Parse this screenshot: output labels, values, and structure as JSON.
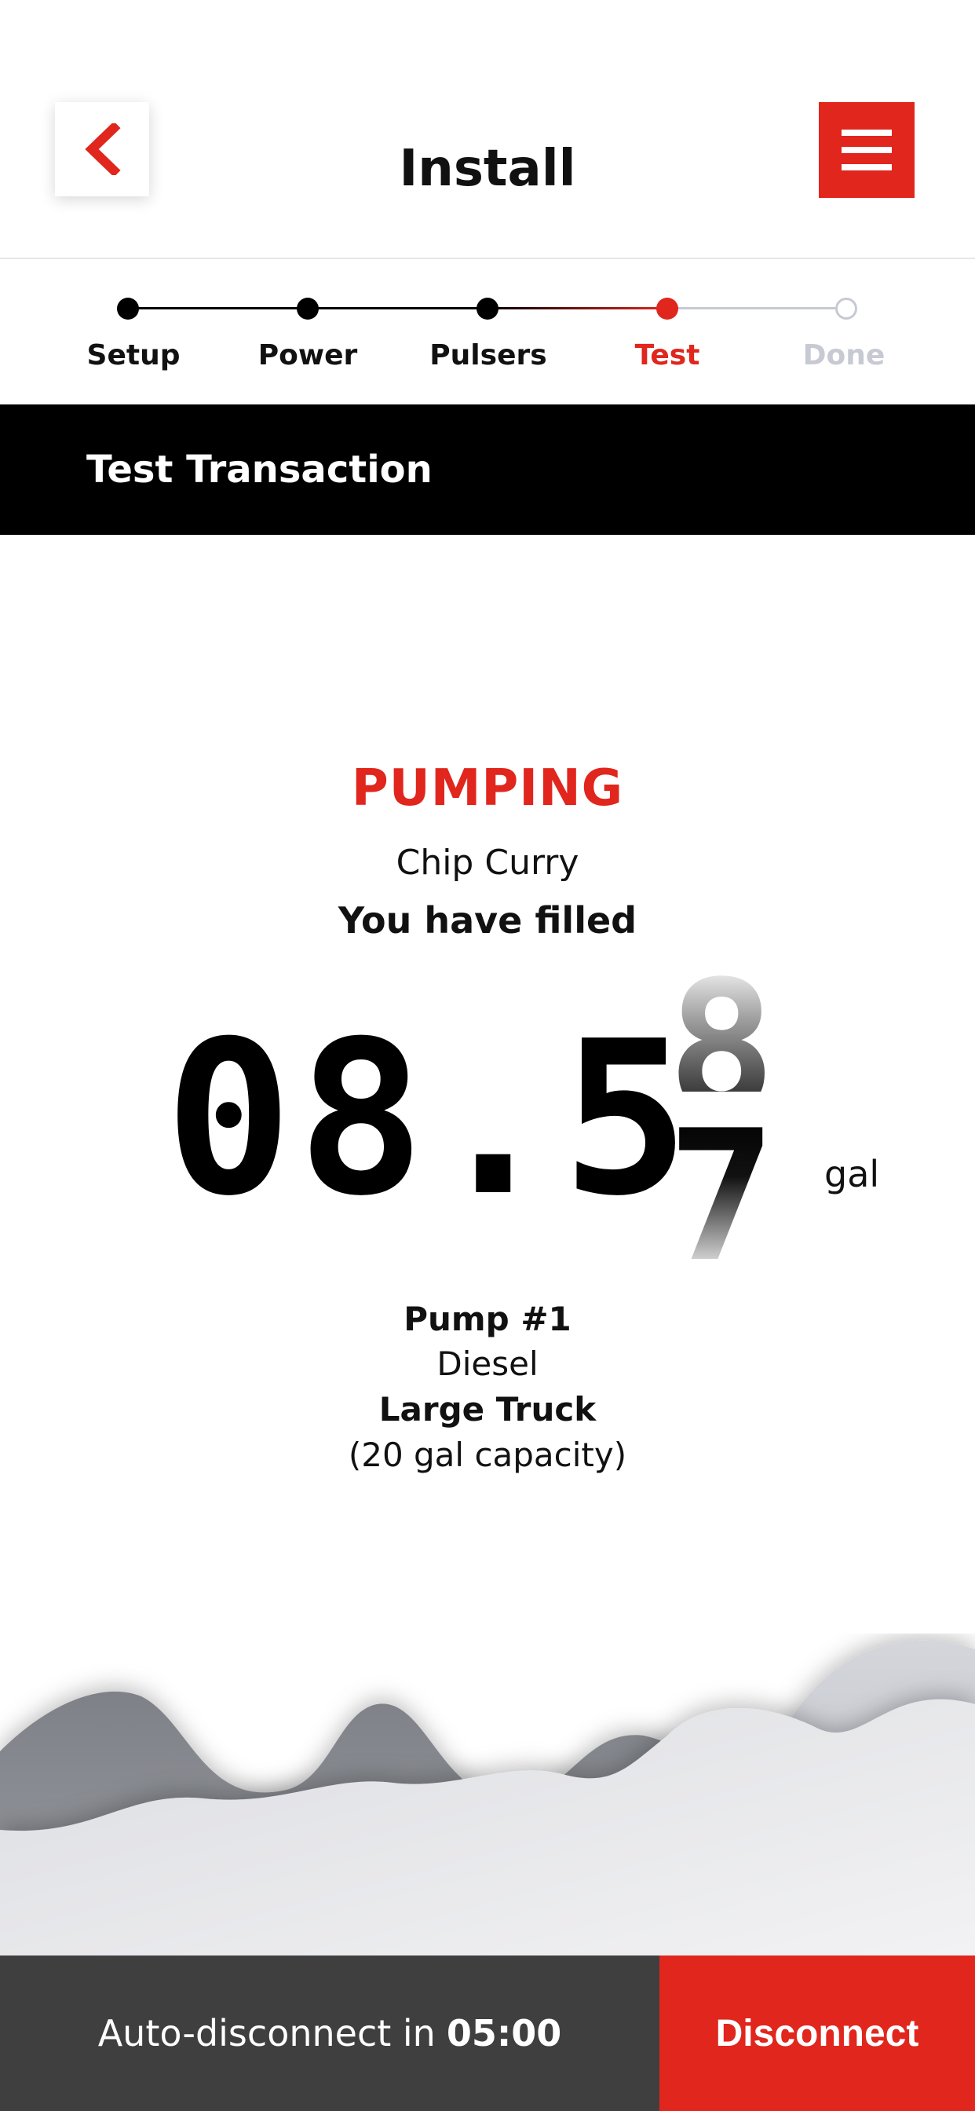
{
  "header": {
    "title": "Install",
    "back_icon": "chevron-left-icon",
    "menu_icon": "hamburger-menu-icon"
  },
  "stepper": {
    "steps": [
      {
        "label": "Setup",
        "state": "completed"
      },
      {
        "label": "Power",
        "state": "completed"
      },
      {
        "label": "Pulsers",
        "state": "completed"
      },
      {
        "label": "Test",
        "state": "active"
      },
      {
        "label": "Done",
        "state": "pending"
      }
    ]
  },
  "section": {
    "title": "Test Transaction"
  },
  "transaction": {
    "status": "PUMPING",
    "customer": "Chip Curry",
    "filled_label": "You have filled",
    "meter": {
      "digits": "08.5",
      "rolling_previous": "8",
      "rolling_current": "7",
      "unit": "gal"
    },
    "pump": "Pump #1",
    "fuel": "Diesel",
    "vehicle": "Large Truck",
    "capacity": "(20 gal capacity)"
  },
  "footer": {
    "auto_disconnect_label": "Auto-disconnect in",
    "auto_disconnect_time": "05:00",
    "disconnect_label": "Disconnect"
  },
  "colors": {
    "accent": "#e0261d",
    "dark": "#000000",
    "footer_bg": "#3f3f3f",
    "pending": "#c7cad3"
  }
}
